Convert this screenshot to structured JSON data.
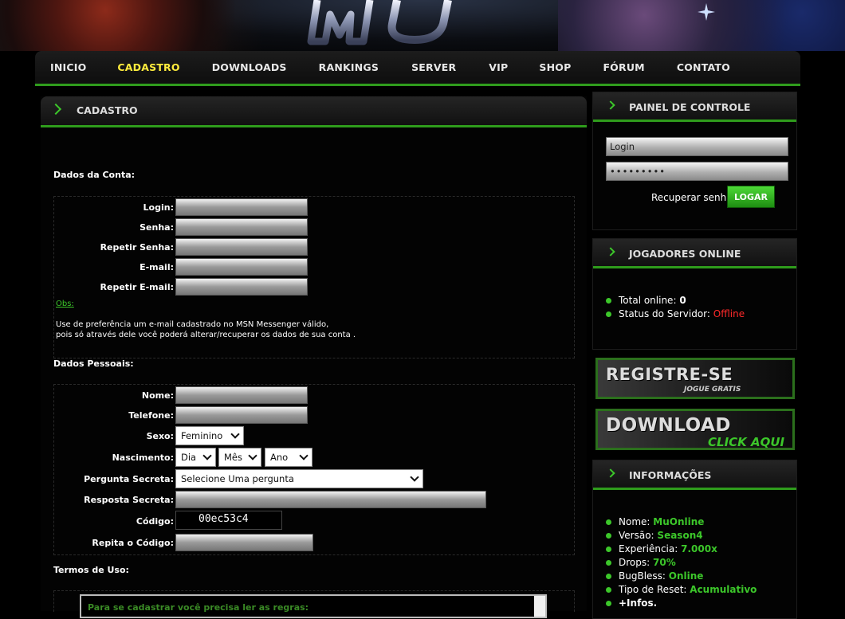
{
  "nav": {
    "items": [
      "INICIO",
      "CADASTRO",
      "DOWNLOADS",
      "RANKINGS",
      "SERVER",
      "VIP",
      "SHOP",
      "FÓRUM",
      "CONTATO"
    ],
    "active": "CADASTRO"
  },
  "main": {
    "title": "CADASTRO",
    "account_section": "Dados da Conta:",
    "account_fields": [
      "Login:",
      "Senha:",
      "Repetir Senha:",
      "E-mail:",
      "Repetir E-mail:"
    ],
    "obs_label": "Obs:",
    "obs_line1": "Use de preferência um e-mail cadastrado no MSN Messenger válido,",
    "obs_line2": "pois só através dele você poderá alterar/recuperar os dados de sua conta .",
    "personal_section": "Dados Pessoais:",
    "labels": {
      "nome": "Nome:",
      "telefone": "Telefone:",
      "sexo": "Sexo:",
      "nascimento": "Nascimento:",
      "pergunta": "Pergunta Secreta:",
      "resposta": "Resposta Secreta:",
      "codigo": "Código:",
      "repita": "Repita o Código:"
    },
    "selects": {
      "sexo": "Feminino",
      "dia": "Dia",
      "mes": "Mês",
      "ano": "Ano",
      "pergunta": "Selecione Uma pergunta"
    },
    "captcha": "00ec53c4",
    "terms_section": "Termos de Uso:",
    "terms_text": "Para se cadastrar você precisa ler as regras:"
  },
  "sidebar": {
    "control_title": "PAINEL DE CONTROLE",
    "login_value": "Login",
    "password_value": "•••••••••",
    "recover": "Recuperar senha",
    "login_button": "LOGAR",
    "online_title": "JOGADORES ONLINE",
    "total_online_label": "Total online:",
    "total_online_value": "0",
    "server_status_label": "Status do Servidor:",
    "server_status_value": "Offline",
    "register_banner": "REGISTRE-SE",
    "register_sub": "JOGUE GRATIS",
    "download_banner": "DOWNLOAD",
    "download_sub": "CLICK AQUI",
    "info_title": "INFORMAÇÕES",
    "info": [
      {
        "label": "Nome:",
        "value": "MuOnline"
      },
      {
        "label": "Versão:",
        "value": "Season4"
      },
      {
        "label": "Experiência:",
        "value": "7.000x"
      },
      {
        "label": "Drops:",
        "value": "70%"
      },
      {
        "label": "BugBless:",
        "value": "Online"
      },
      {
        "label": "Tipo de Reset:",
        "value": "Acumulativo"
      }
    ],
    "more_info": "+Infos."
  },
  "colors": {
    "accent": "#2f9c1c",
    "active_nav": "#ffec3d",
    "offline": "#ff2a2a"
  }
}
